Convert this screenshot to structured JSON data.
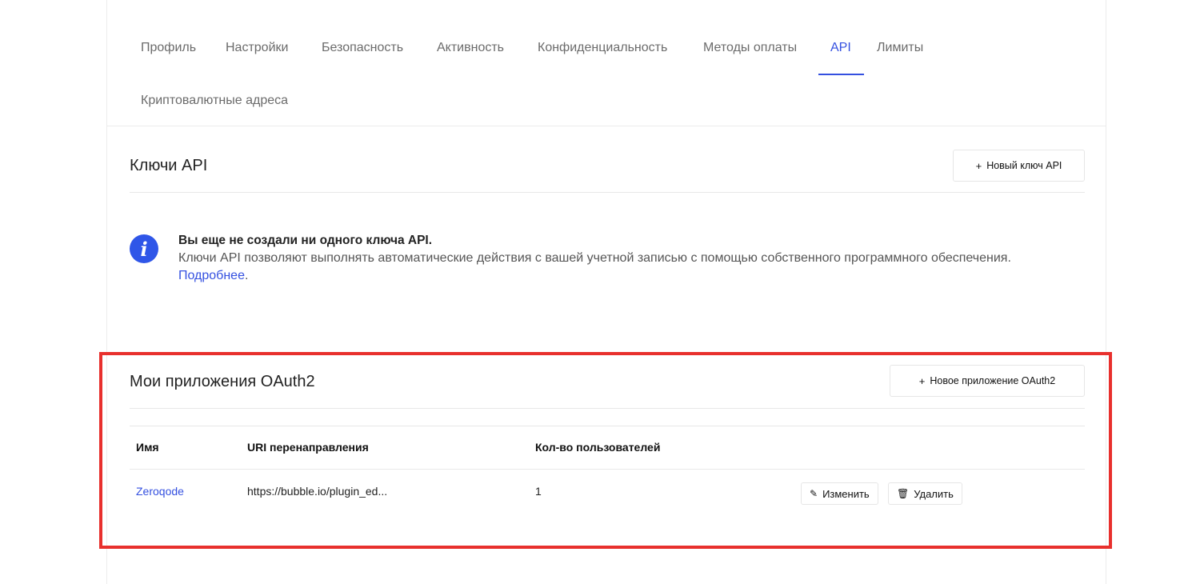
{
  "tabs": [
    {
      "label": "Профиль",
      "active": false
    },
    {
      "label": "Настройки",
      "active": false
    },
    {
      "label": "Безопасность",
      "active": false
    },
    {
      "label": "Активность",
      "active": false
    },
    {
      "label": "Конфиденциальность",
      "active": false
    },
    {
      "label": "Методы оплаты",
      "active": false
    },
    {
      "label": "API",
      "active": true
    },
    {
      "label": "Лимиты",
      "active": false
    },
    {
      "label": "Криптовалютные адреса",
      "active": false
    }
  ],
  "api_keys": {
    "title": "Ключи API",
    "new_button_label": "Новый ключ API",
    "plus": "+",
    "info": {
      "title": "Вы еще не создали ни одного ключа API.",
      "text": "Ключи API позволяют выполнять автоматические действия с вашей учетной записью с помощью собственного программного обеспечения. ",
      "link_text": "Подробнее",
      "trailing": "."
    }
  },
  "oauth": {
    "title": "Мои приложения OAuth2",
    "new_button_label": "Новое приложение OAuth2",
    "plus": "+",
    "columns": [
      "Имя",
      "URI перенаправления",
      "Кол-во пользователей"
    ],
    "rows": [
      {
        "name": "Zeroqode",
        "redirect_uri": "https://bubble.io/plugin_ed...",
        "users": "1"
      }
    ],
    "edit_label": "Изменить",
    "delete_label": "Удалить"
  },
  "colors": {
    "accent": "#3450e0",
    "highlight_frame": "#e8302d",
    "info_icon": "#2f56e8"
  },
  "icons": {
    "info": "info-icon",
    "edit": "pencil-icon",
    "delete": "trash-icon"
  }
}
